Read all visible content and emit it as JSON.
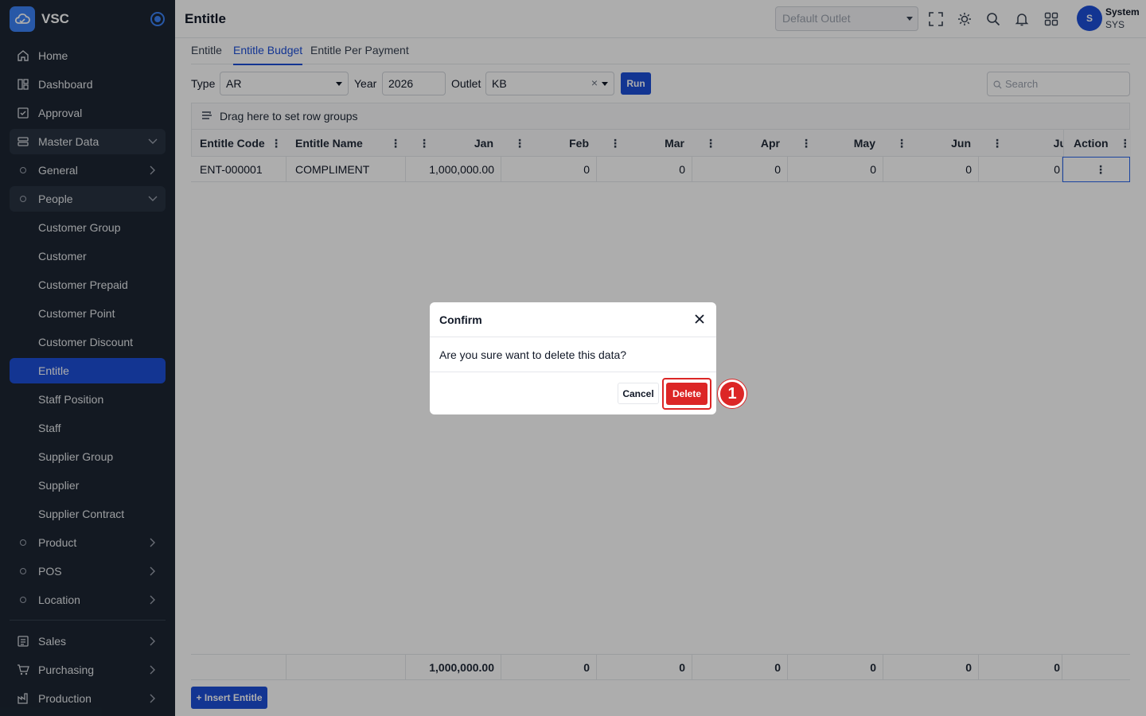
{
  "app": {
    "name": "VSC"
  },
  "sidebar": {
    "items": [
      {
        "label": "Home",
        "icon": "home-icon"
      },
      {
        "label": "Dashboard",
        "icon": "dashboard-icon"
      },
      {
        "label": "Approval",
        "icon": "approval-icon"
      },
      {
        "label": "Master Data",
        "icon": "database-icon",
        "expanded": true
      },
      {
        "label": "General",
        "icon": "circle-icon"
      },
      {
        "label": "People",
        "icon": "circle-icon",
        "expanded": true
      },
      {
        "label": "Customer Group"
      },
      {
        "label": "Customer"
      },
      {
        "label": "Customer Prepaid"
      },
      {
        "label": "Customer Point"
      },
      {
        "label": "Customer Discount"
      },
      {
        "label": "Entitle",
        "active": true
      },
      {
        "label": "Staff Position"
      },
      {
        "label": "Staff"
      },
      {
        "label": "Supplier Group"
      },
      {
        "label": "Supplier"
      },
      {
        "label": "Supplier Contract"
      },
      {
        "label": "Product",
        "icon": "circle-icon"
      },
      {
        "label": "POS",
        "icon": "circle-icon"
      },
      {
        "label": "Location",
        "icon": "circle-icon"
      },
      {
        "label": "Sales",
        "icon": "sales-icon"
      },
      {
        "label": "Purchasing",
        "icon": "cart-icon"
      },
      {
        "label": "Production",
        "icon": "factory-icon"
      }
    ]
  },
  "header": {
    "title": "Entitle",
    "outlet_placeholder": "Default Outlet",
    "user": {
      "initial": "S",
      "name": "System",
      "code": "SYS"
    }
  },
  "tabs": [
    "Entitle",
    "Entitle Budget",
    "Entitle Per Payment"
  ],
  "active_tab": "Entitle Budget",
  "filters": {
    "type_label": "Type",
    "type_value": "AR",
    "year_label": "Year",
    "year_value": "2026",
    "outlet_label": "Outlet",
    "outlet_value": "KB",
    "run_label": "Run",
    "search_placeholder": "Search"
  },
  "grid": {
    "group_bar_text": "Drag here to set row groups",
    "columns": [
      "Entitle Code",
      "Entitle Name",
      "Jan",
      "Feb",
      "Mar",
      "Apr",
      "May",
      "Jun",
      "Ju",
      "Action"
    ],
    "rows": [
      {
        "code": "ENT-000001",
        "name": "COMPLIMENT",
        "jan": "1,000,000.00",
        "feb": "0",
        "mar": "0",
        "apr": "0",
        "may": "0",
        "jun": "0",
        "jul": "0"
      }
    ],
    "totals": {
      "jan": "1,000,000.00",
      "feb": "0",
      "mar": "0",
      "apr": "0",
      "may": "0",
      "jun": "0",
      "jul": "0"
    }
  },
  "insert_button": "+ Insert Entitle",
  "modal": {
    "title": "Confirm",
    "message": "Are you sure want to delete this data?",
    "cancel_label": "Cancel",
    "delete_label": "Delete"
  },
  "annotation": {
    "step": "1"
  },
  "colors": {
    "primary": "#1d4ed8",
    "danger": "#dc2626",
    "sidebar_bg": "#1c2633"
  }
}
